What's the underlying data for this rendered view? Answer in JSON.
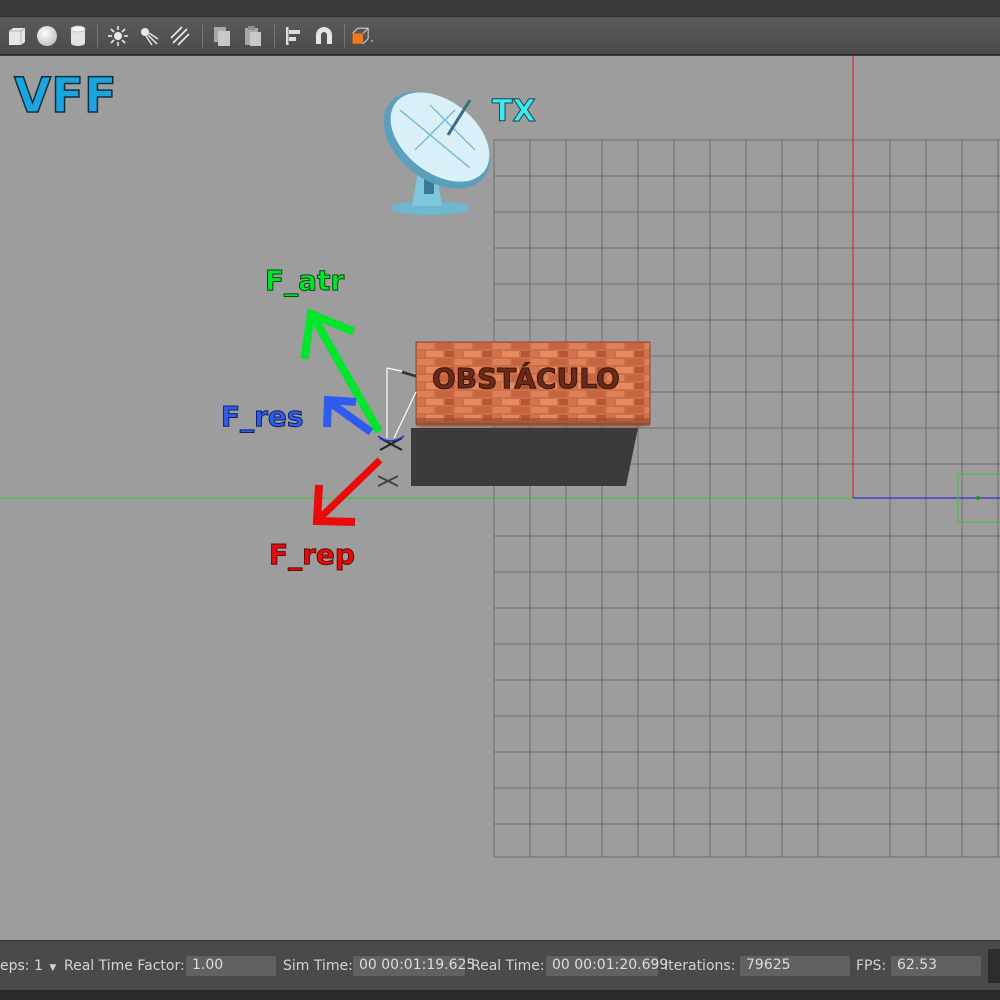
{
  "toolbar": {
    "tools": [
      {
        "name": "box-shape-icon"
      },
      {
        "name": "sphere-shape-icon"
      },
      {
        "name": "cylinder-shape-icon"
      },
      {
        "name": "point-light-icon"
      },
      {
        "name": "spot-light-icon"
      },
      {
        "name": "directional-light-icon"
      },
      {
        "name": "copy-icon"
      },
      {
        "name": "paste-icon"
      },
      {
        "name": "align-icon"
      },
      {
        "name": "snap-magnet-icon"
      },
      {
        "name": "view-angle-icon"
      }
    ],
    "accent_color": "#f27a1c"
  },
  "overlay": {
    "title": "VFF",
    "tx_label": "TX",
    "obstacle_label": "OBSTÁCULO",
    "f_atr": "F_atr",
    "f_res": "F_res",
    "f_rep": "F_rep",
    "colors": {
      "title": "#1aa4e0",
      "tx": "#3ee8f0",
      "f_atr": "#00e62b",
      "f_res": "#2f5cf0",
      "f_rep": "#ea0a0a"
    }
  },
  "statusbar": {
    "steps_label": "eps:",
    "steps_value": "1",
    "real_time_factor_label": "Real Time Factor:",
    "real_time_factor_value": "1.00",
    "sim_time_label": "Sim Time:",
    "sim_time_value": "00 00:01:19.625",
    "real_time_label": "Real Time:",
    "real_time_value": "00 00:01:20.699",
    "iterations_label": "Iterations:",
    "iterations_value": "79625",
    "fps_label": "FPS:",
    "fps_value": "62.53"
  }
}
